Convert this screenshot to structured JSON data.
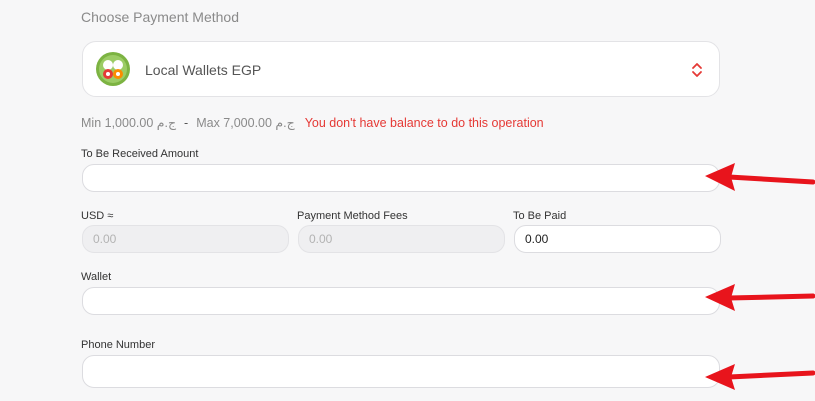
{
  "section": {
    "title": "Choose Payment Method"
  },
  "payment_method": {
    "selected": "Local Wallets EGP",
    "logo_icon": "local-wallets-logo",
    "accent_color": "#e53935"
  },
  "limits": {
    "min": "Min 1,000.00 ج.م",
    "separator": "-",
    "max": "Max 7,000.00 ج.م",
    "error": "You don't have balance to do this operation",
    "error_color": "#e53935"
  },
  "form": {
    "received_amount": {
      "label": "To Be Received Amount",
      "value": ""
    },
    "usd": {
      "label": "USD ≈",
      "value": "0.00"
    },
    "fees": {
      "label": "Payment Method Fees",
      "value": "0.00"
    },
    "to_be_paid": {
      "label": "To Be Paid",
      "value": "0.00"
    },
    "wallet": {
      "label": "Wallet",
      "value": ""
    },
    "phone": {
      "label": "Phone Number",
      "value": ""
    }
  },
  "annotations": {
    "arrow_color": "#e8141c"
  }
}
